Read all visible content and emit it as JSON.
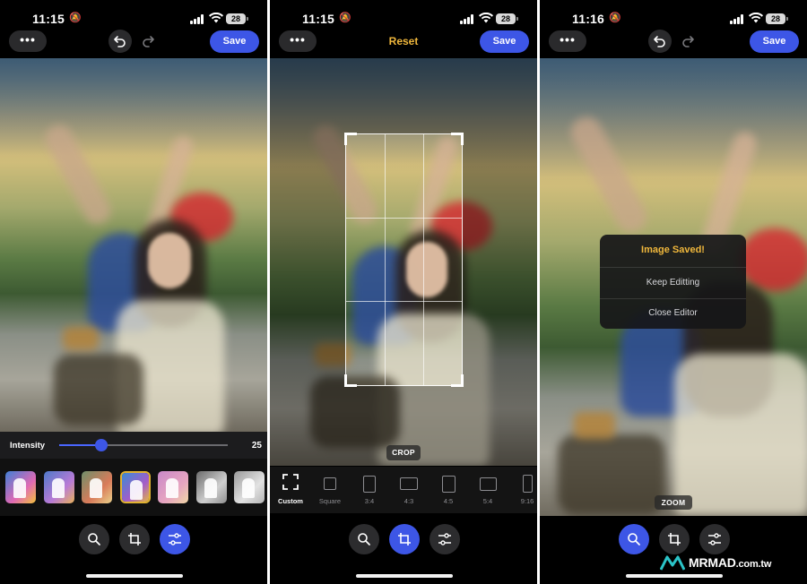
{
  "status": {
    "time_1": "11:15",
    "time_2": "11:15",
    "time_3": "11:16",
    "battery": "28"
  },
  "toolbar": {
    "more_label": "•••",
    "save_label": "Save",
    "reset_label": "Reset"
  },
  "intensity": {
    "label": "Intensity",
    "value": "25",
    "fraction": 0.25
  },
  "filters": {
    "count": 7,
    "selected_index": 3
  },
  "crop": {
    "overlay_label": "CROP",
    "ratios": [
      {
        "label": "Custom",
        "active": true
      },
      {
        "label": "Square",
        "active": false
      },
      {
        "label": "3:4",
        "active": false
      },
      {
        "label": "4:3",
        "active": false
      },
      {
        "label": "4:5",
        "active": false
      },
      {
        "label": "5:4",
        "active": false
      },
      {
        "label": "9:16",
        "active": false
      }
    ]
  },
  "zoom": {
    "overlay_label": "ZOOM"
  },
  "saved_dialog": {
    "title": "Image Saved!",
    "keep_editing": "Keep Editting",
    "close_editor": "Close Editor"
  },
  "bottom_tools": [
    "zoom-icon",
    "crop-icon",
    "adjust-sliders-icon"
  ],
  "colors": {
    "accent": "#3d56e6",
    "highlight": "#f0b73c",
    "filter_selected": "#e1b232"
  },
  "watermark": {
    "brand": "MRMAD",
    "suffix": ".com.tw"
  }
}
